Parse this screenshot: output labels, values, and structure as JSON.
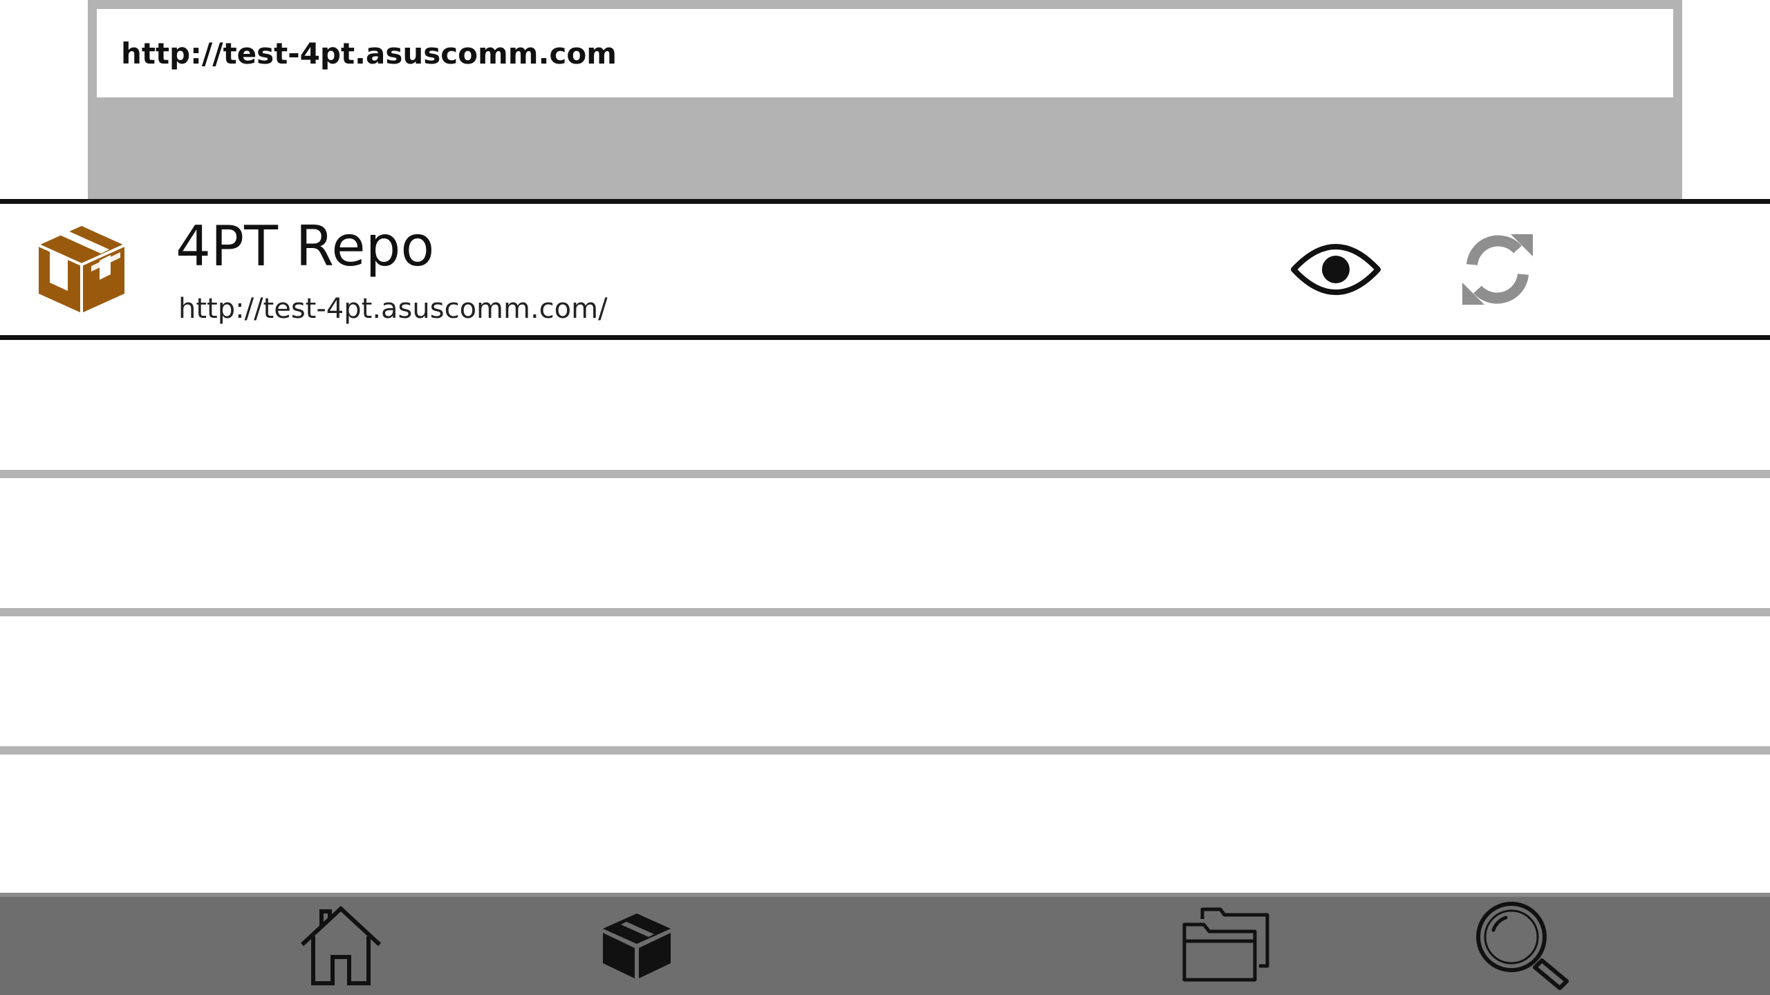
{
  "url_entry": {
    "value": "http://test-4pt.asuscomm.com"
  },
  "repos": [
    {
      "name": "4PT Repo",
      "url": "http://test-4pt.asuscomm.com/",
      "icon": "package-box-icon",
      "selected": true
    }
  ],
  "row_actions": {
    "view_icon": "eye-icon",
    "refresh_icon": "refresh-icon"
  },
  "tab_bar": {
    "tabs": [
      {
        "icon": "home-icon"
      },
      {
        "icon": "package-icon",
        "active": true
      },
      {
        "icon": "folders-icon"
      },
      {
        "icon": "search-icon"
      }
    ]
  },
  "colors": {
    "url_panel_background": "#b3b3b3",
    "row_separator": "#b3b3b3",
    "selected_row_border": "#111111",
    "tab_bar_background": "#6e6e6e",
    "package_icon_brown": "#9a5a0e",
    "refresh_icon_gray": "#8f8f8f"
  }
}
